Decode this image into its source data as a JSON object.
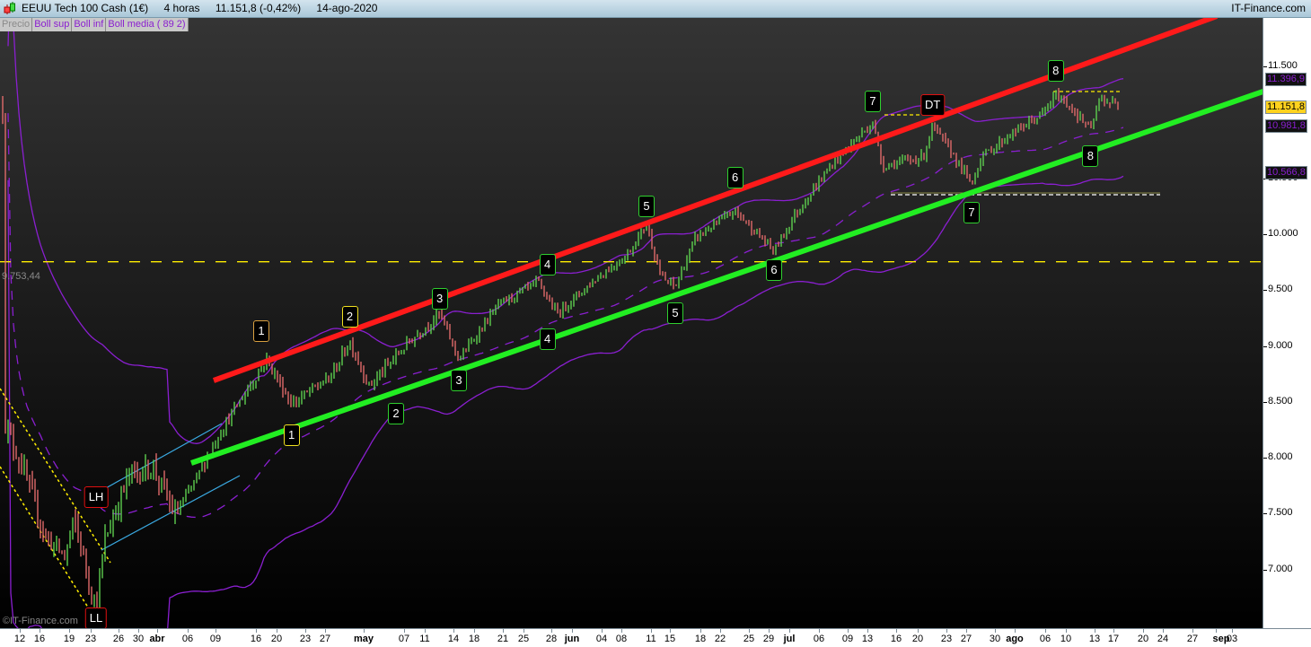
{
  "header": {
    "instrument": "EEUU Tech 100 Cash (1€)",
    "timeframe": "4 horas",
    "price_change": "11.151,8 (-0,42%)",
    "date": "14-ago-2020",
    "brand": "IT-Finance.com"
  },
  "legend": [
    "Precio",
    "Boll sup",
    "Boll inf",
    "Boll media ( 89 2)"
  ],
  "copyright": "©IT-Finance.com",
  "colors": {
    "up": "#5ecf4f",
    "down": "#e06a6a",
    "bollinger": "#8a1fd0",
    "resistance": "#ff1a1a",
    "support": "#22ee22",
    "channel": "#3aa8e0",
    "level": "#ffee00"
  },
  "level_line": {
    "label": "9.753,44",
    "value": 9753.44
  },
  "value_boxes": [
    {
      "label": "11.396,9",
      "value": 11396.9,
      "kind": "boll-sup"
    },
    {
      "label": "11.151,8",
      "value": 11151.8,
      "kind": "current"
    },
    {
      "label": "10.981,8",
      "value": 10981.8,
      "kind": "boll-media"
    },
    {
      "label": "10.566,8",
      "value": 10566.8,
      "kind": "boll-inf"
    }
  ],
  "annotations": [
    {
      "text": "LH",
      "date": "03-23",
      "price": 7650,
      "color": "#e01010"
    },
    {
      "text": "LL",
      "date": "03-23",
      "price": 6560,
      "color": "#e01010"
    },
    {
      "text": "1",
      "date": "04-16",
      "price": 9130,
      "color": "#d9a040"
    },
    {
      "text": "2",
      "date": "04-29",
      "price": 9260,
      "color": "#f0e020"
    },
    {
      "text": "3",
      "date": "05-12",
      "price": 9420,
      "color": "#2fd02f"
    },
    {
      "text": "4",
      "date": "05-27",
      "price": 9730,
      "color": "#2fd02f"
    },
    {
      "text": "5",
      "date": "06-10",
      "price": 10250,
      "color": "#2fd02f"
    },
    {
      "text": "6",
      "date": "06-23",
      "price": 10510,
      "color": "#2fd02f"
    },
    {
      "text": "7",
      "date": "07-13",
      "price": 11190,
      "color": "#2fd02f"
    },
    {
      "text": "DT",
      "date": "07-21",
      "price": 11160,
      "color": "#e01010"
    },
    {
      "text": "8",
      "date": "08-07",
      "price": 11460,
      "color": "#2fd02f"
    },
    {
      "text": "1",
      "date": "04-21",
      "price": 8200,
      "color": "#f0e020"
    },
    {
      "text": "2",
      "date": "05-05",
      "price": 8390,
      "color": "#2fd02f"
    },
    {
      "text": "3",
      "date": "05-14",
      "price": 8690,
      "color": "#2fd02f"
    },
    {
      "text": "4",
      "date": "05-27",
      "price": 9060,
      "color": "#2fd02f"
    },
    {
      "text": "5",
      "date": "06-15",
      "price": 9290,
      "color": "#2fd02f"
    },
    {
      "text": "6",
      "date": "06-29",
      "price": 9680,
      "color": "#2fd02f"
    },
    {
      "text": "7",
      "date": "07-27",
      "price": 10190,
      "color": "#2fd02f"
    },
    {
      "text": "8",
      "date": "08-12",
      "price": 10700,
      "color": "#2fd02f"
    }
  ],
  "chart_data": {
    "type": "candlestick",
    "title": "EEUU Tech 100 Cash (1€) 4 horas",
    "ylim": [
      6500,
      11850
    ],
    "yticks": [
      {
        "label": "11.500",
        "value": 11500
      },
      {
        "label": "10.500",
        "value": 10500
      },
      {
        "label": "10.000",
        "value": 10000
      },
      {
        "label": "9.500",
        "value": 9500
      },
      {
        "label": "9.000",
        "value": 9000
      },
      {
        "label": "8.500",
        "value": 8500
      },
      {
        "label": "8.000",
        "value": 8000
      },
      {
        "label": "7.500",
        "value": 7500
      },
      {
        "label": "7.000",
        "value": 7000
      }
    ],
    "xticks": [
      "12",
      "16",
      "19",
      "23",
      "26",
      "30",
      "abr",
      "06",
      "09",
      "16",
      "20",
      "23",
      "27",
      "may",
      "07",
      "11",
      "14",
      "18",
      "21",
      "25",
      "28",
      "jun",
      "04",
      "08",
      "11",
      "15",
      "18",
      "22",
      "25",
      "29",
      "jul",
      "06",
      "09",
      "13",
      "16",
      "20",
      "23",
      "27",
      "30",
      "ago",
      "06",
      "10",
      "13",
      "17",
      "20",
      "24",
      "27",
      "sep",
      "03"
    ],
    "price_path": [
      [
        "03-09",
        8320
      ],
      [
        "03-12",
        7840
      ],
      [
        "03-16",
        7300
      ],
      [
        "03-18",
        7117
      ],
      [
        "03-19",
        7440
      ],
      [
        "03-23",
        6640
      ],
      [
        "03-24",
        7280
      ],
      [
        "03-27",
        7840
      ],
      [
        "03-31",
        7920
      ],
      [
        "04-03",
        7480
      ],
      [
        "04-06",
        7760
      ],
      [
        "04-09",
        8240
      ],
      [
        "04-14",
        8640
      ],
      [
        "04-17",
        8880
      ],
      [
        "04-21",
        8480
      ],
      [
        "04-27",
        8720
      ],
      [
        "04-29",
        9040
      ],
      [
        "05-01",
        8640
      ],
      [
        "05-07",
        9040
      ],
      [
        "05-12",
        9290
      ],
      [
        "05-14",
        8880
      ],
      [
        "05-20",
        9370
      ],
      [
        "05-26",
        9570
      ],
      [
        "05-28",
        9290
      ],
      [
        "06-03",
        9610
      ],
      [
        "06-08",
        9810
      ],
      [
        "06-10",
        10090
      ],
      [
        "06-12",
        9610
      ],
      [
        "06-15",
        9530
      ],
      [
        "06-17",
        9970
      ],
      [
        "06-23",
        10210
      ],
      [
        "06-29",
        9850
      ],
      [
        "07-01",
        10170
      ],
      [
        "07-07",
        10650
      ],
      [
        "07-13",
        11000
      ],
      [
        "07-14",
        10610
      ],
      [
        "07-20",
        10690
      ],
      [
        "07-21",
        10970
      ],
      [
        "07-23",
        10730
      ],
      [
        "07-27",
        10450
      ],
      [
        "07-28",
        10690
      ],
      [
        "07-31",
        10890
      ],
      [
        "08-05",
        11090
      ],
      [
        "08-07",
        11250
      ],
      [
        "08-10",
        11130
      ],
      [
        "08-12",
        10930
      ],
      [
        "08-13",
        11210
      ],
      [
        "08-14",
        11151.8
      ]
    ],
    "bollinger": {
      "period": 89,
      "k": 2
    },
    "trendlines": [
      {
        "name": "resistance",
        "from": [
          "04-15",
          8700
        ],
        "to": [
          "sep",
          11950
        ]
      },
      {
        "name": "support",
        "from": [
          "04-06",
          7960
        ],
        "to": [
          "sep+",
          11430
        ]
      }
    ]
  }
}
